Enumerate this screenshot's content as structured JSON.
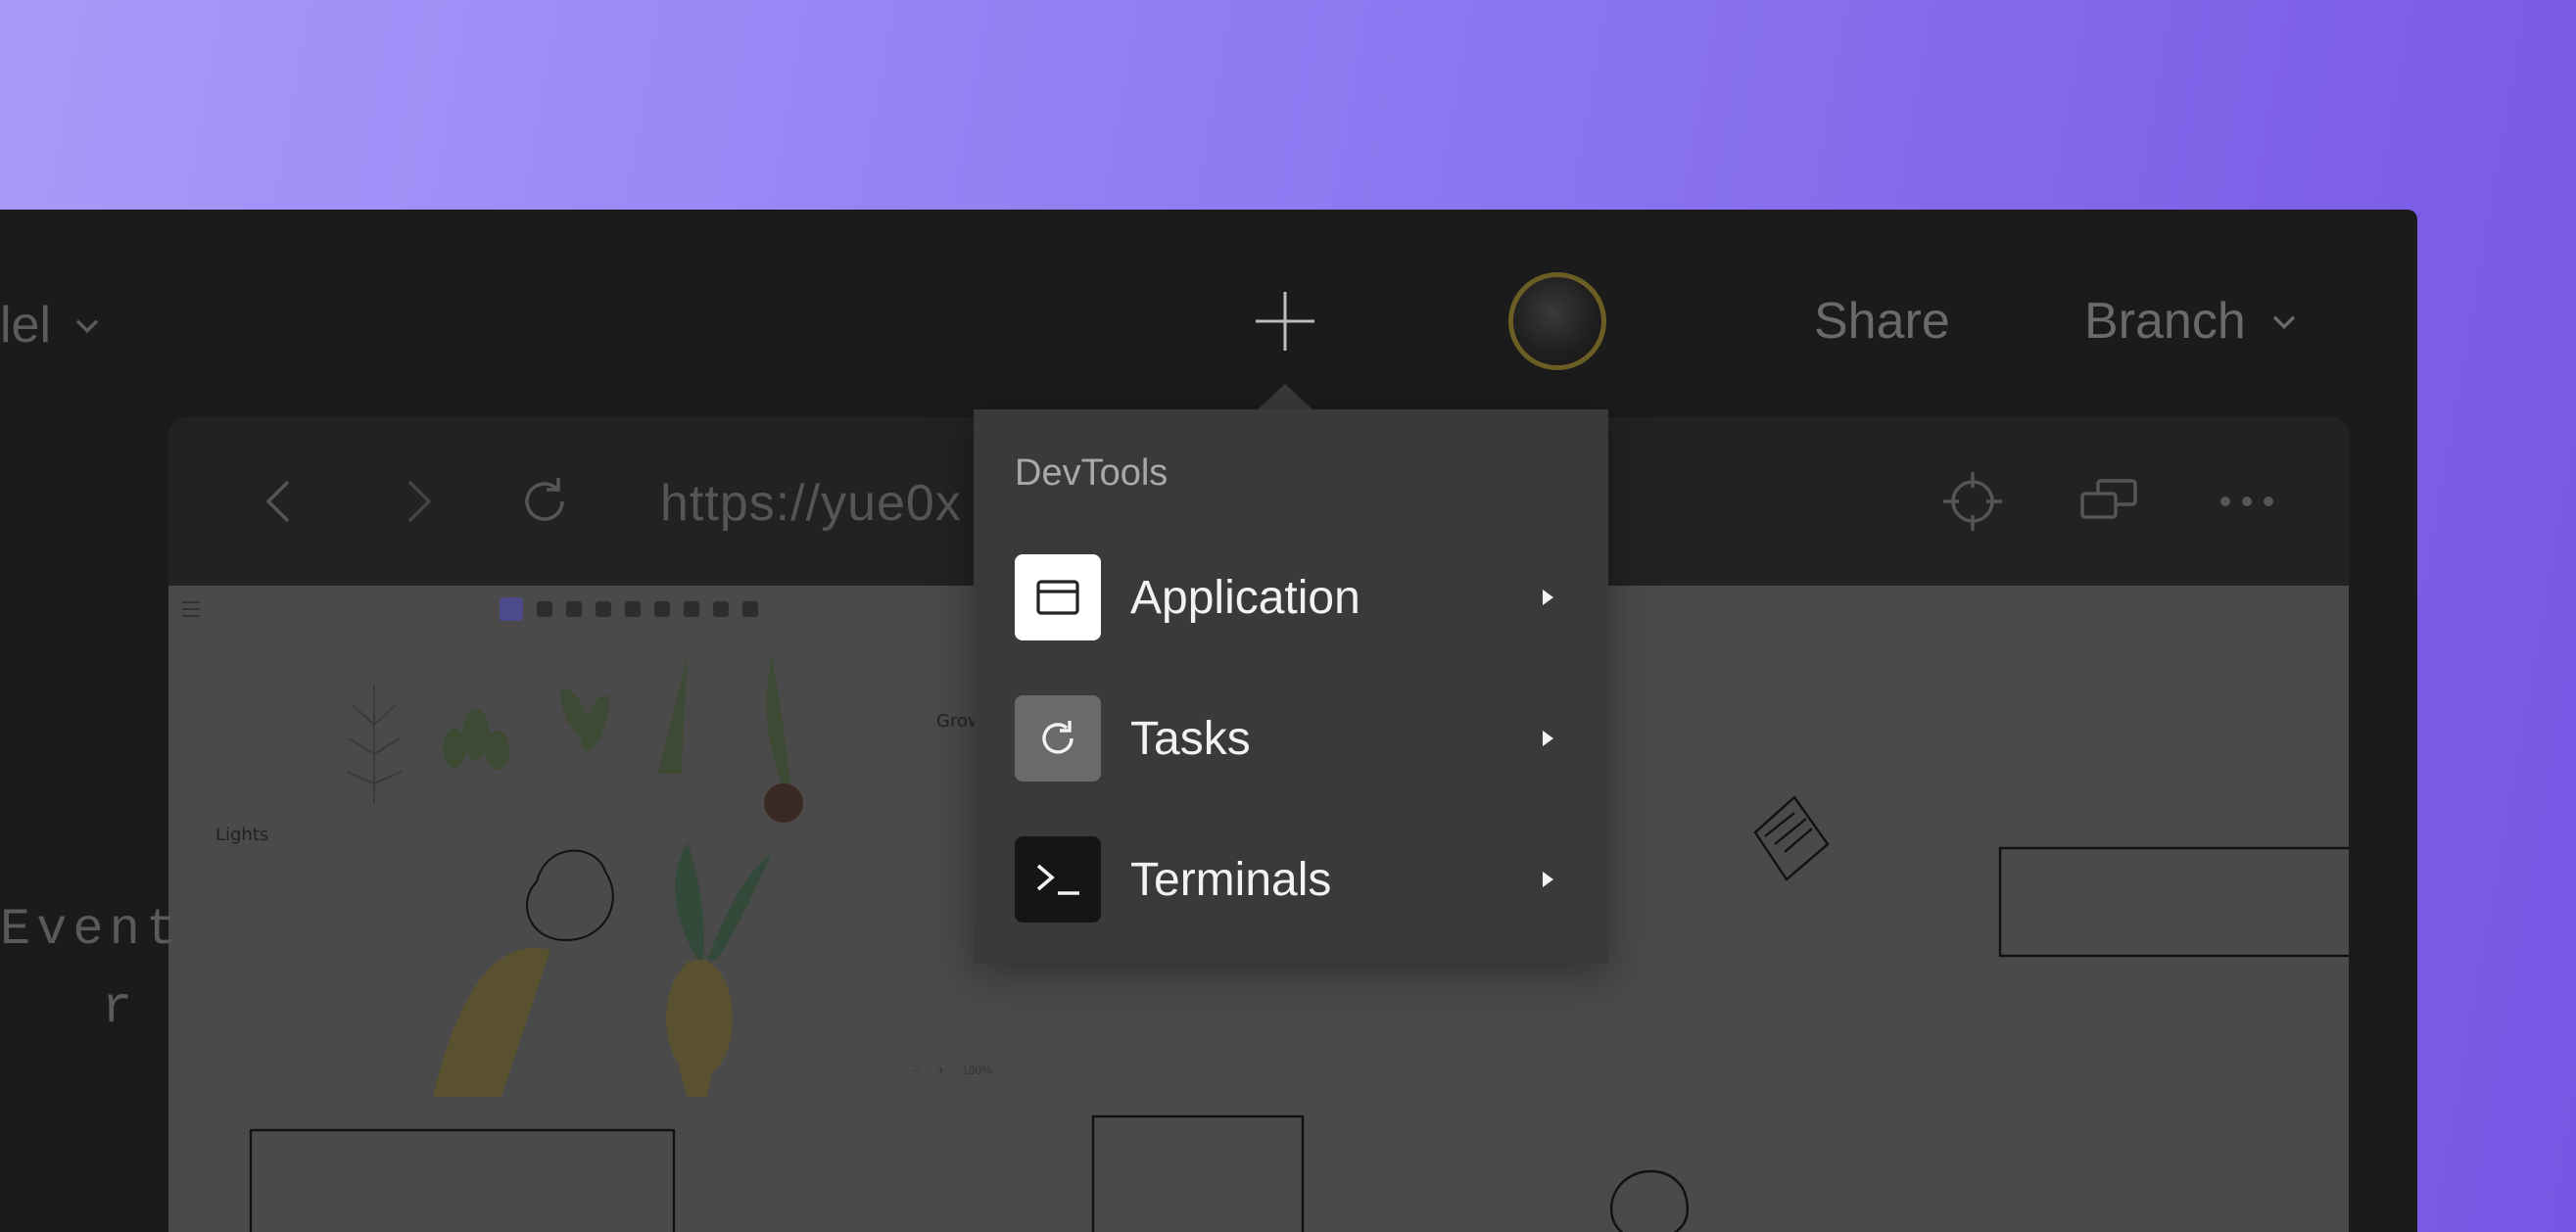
{
  "topbar": {
    "project_name": "lel",
    "share_label": "Share",
    "branch_label": "Branch"
  },
  "browser": {
    "url": "https://yue0x"
  },
  "canvas": {
    "label_lights": "Lights",
    "label_grow": "Grow",
    "zoom_level": "100%"
  },
  "sidebar_text": {
    "line1": "Event",
    "line2": "r"
  },
  "devtools_menu": {
    "title": "DevTools",
    "items": [
      {
        "label": "Application",
        "icon": "window-icon"
      },
      {
        "label": "Tasks",
        "icon": "refresh-icon"
      },
      {
        "label": "Terminals",
        "icon": "terminal-icon"
      }
    ]
  },
  "colors": {
    "background_start": "#a99af9",
    "background_end": "#7756e3",
    "window": "#1b1b1b",
    "popup": "#3a3a3a"
  }
}
